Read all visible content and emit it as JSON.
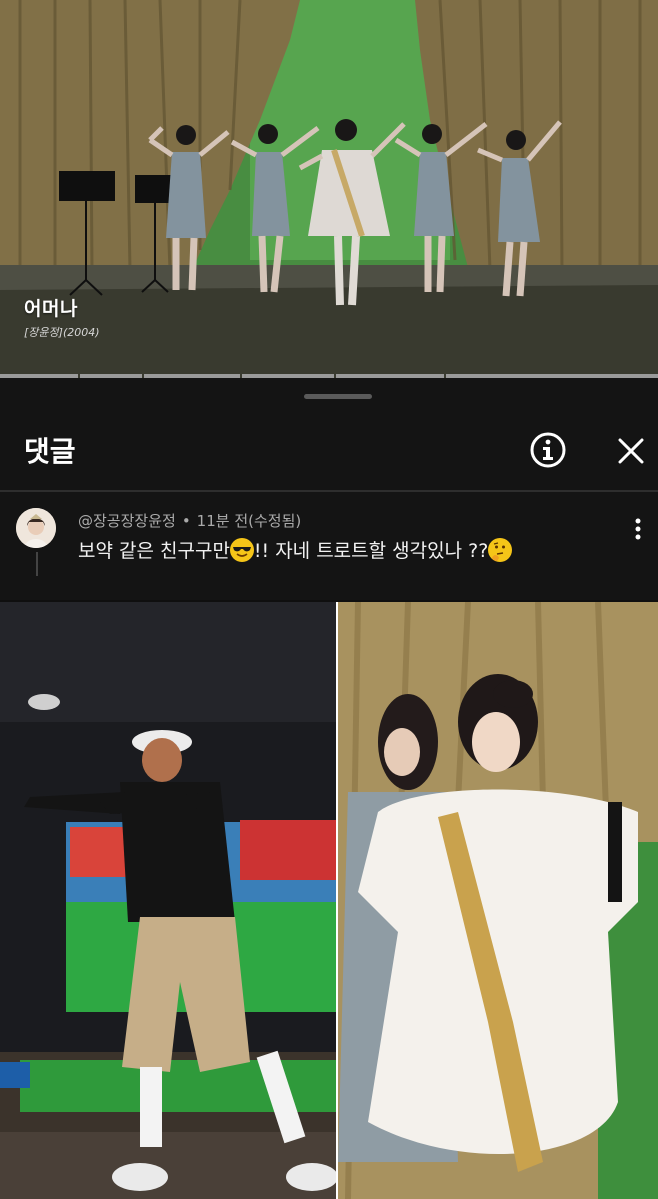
{
  "video": {
    "song_title": "어머나",
    "song_subtitle": "[장윤정](2004)",
    "chapter_segments": 6
  },
  "comments": {
    "title": "댓글",
    "info_icon": "info-icon",
    "close_icon": "close-icon",
    "items": [
      {
        "author": "@장공장장윤정",
        "separator": "•",
        "time": "11분 전(수정됨)",
        "text_part1": "보약 같은 친구구만",
        "emoji1": "smiling-face-with-sunglasses",
        "text_part2": "!! 자네 트로트할 생각있나 ??",
        "emoji2": "thinking-face",
        "more_icon": "more-vert-icon"
      }
    ]
  },
  "photos": {
    "left": "golf-simulator-dance-photo",
    "right": "stage-performer-photo"
  },
  "colors": {
    "background": "#0f0f0f",
    "sheet": "#141414",
    "text": "#f1f1f1",
    "meta": "#aaaaaa"
  }
}
